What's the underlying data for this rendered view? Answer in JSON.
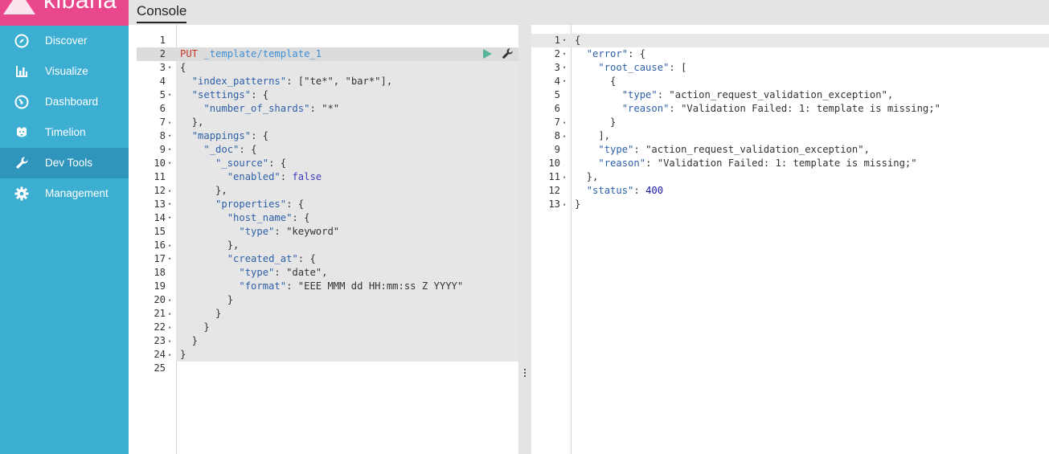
{
  "brand": {
    "name": "kibana"
  },
  "header": {
    "title": "Console"
  },
  "nav": {
    "items": [
      {
        "label": "Discover",
        "icon": "compass-icon"
      },
      {
        "label": "Visualize",
        "icon": "bar-chart-icon"
      },
      {
        "label": "Dashboard",
        "icon": "dashboard-icon"
      },
      {
        "label": "Timelion",
        "icon": "timelion-icon"
      },
      {
        "label": "Dev Tools",
        "icon": "wrench-icon",
        "active": true
      },
      {
        "label": "Management",
        "icon": "gear-icon"
      }
    ]
  },
  "request_editor": {
    "lines": [
      {
        "num": "1",
        "fold": "",
        "tokens": []
      },
      {
        "num": "2",
        "fold": "",
        "tokens": [
          {
            "t": "PUT",
            "c": "m"
          },
          {
            "t": " ",
            "c": ""
          },
          {
            "t": "_template/template_1",
            "c": "u"
          }
        ]
      },
      {
        "num": "3",
        "fold": "▾",
        "tokens": [
          {
            "t": "{",
            "c": "s"
          }
        ]
      },
      {
        "num": "4",
        "fold": "",
        "tokens": [
          {
            "t": "  ",
            "c": ""
          },
          {
            "t": "\"index_patterns\"",
            "c": "k"
          },
          {
            "t": ": [",
            "c": "s"
          },
          {
            "t": "\"te*\"",
            "c": "s"
          },
          {
            "t": ", ",
            "c": "s"
          },
          {
            "t": "\"bar*\"",
            "c": "s"
          },
          {
            "t": "],",
            "c": "s"
          }
        ]
      },
      {
        "num": "5",
        "fold": "▾",
        "tokens": [
          {
            "t": "  ",
            "c": ""
          },
          {
            "t": "\"settings\"",
            "c": "k"
          },
          {
            "t": ": {",
            "c": "s"
          }
        ]
      },
      {
        "num": "6",
        "fold": "",
        "tokens": [
          {
            "t": "    ",
            "c": ""
          },
          {
            "t": "\"number_of_shards\"",
            "c": "k"
          },
          {
            "t": ": ",
            "c": "s"
          },
          {
            "t": "\"*\"",
            "c": "s"
          }
        ]
      },
      {
        "num": "7",
        "fold": "▴",
        "tokens": [
          {
            "t": "  },",
            "c": "s"
          }
        ]
      },
      {
        "num": "8",
        "fold": "▾",
        "tokens": [
          {
            "t": "  ",
            "c": ""
          },
          {
            "t": "\"mappings\"",
            "c": "k"
          },
          {
            "t": ": {",
            "c": "s"
          }
        ]
      },
      {
        "num": "9",
        "fold": "▾",
        "tokens": [
          {
            "t": "    ",
            "c": ""
          },
          {
            "t": "\"_doc\"",
            "c": "k"
          },
          {
            "t": ": {",
            "c": "s"
          }
        ]
      },
      {
        "num": "10",
        "fold": "▾",
        "tokens": [
          {
            "t": "      ",
            "c": ""
          },
          {
            "t": "\"_source\"",
            "c": "k"
          },
          {
            "t": ": {",
            "c": "s"
          }
        ]
      },
      {
        "num": "11",
        "fold": "",
        "tokens": [
          {
            "t": "        ",
            "c": ""
          },
          {
            "t": "\"enabled\"",
            "c": "k"
          },
          {
            "t": ": ",
            "c": "s"
          },
          {
            "t": "false",
            "c": "b"
          }
        ]
      },
      {
        "num": "12",
        "fold": "▴",
        "tokens": [
          {
            "t": "      },",
            "c": "s"
          }
        ]
      },
      {
        "num": "13",
        "fold": "▾",
        "tokens": [
          {
            "t": "      ",
            "c": ""
          },
          {
            "t": "\"properties\"",
            "c": "k"
          },
          {
            "t": ": {",
            "c": "s"
          }
        ]
      },
      {
        "num": "14",
        "fold": "▾",
        "tokens": [
          {
            "t": "        ",
            "c": ""
          },
          {
            "t": "\"host_name\"",
            "c": "k"
          },
          {
            "t": ": {",
            "c": "s"
          }
        ]
      },
      {
        "num": "15",
        "fold": "",
        "tokens": [
          {
            "t": "          ",
            "c": ""
          },
          {
            "t": "\"type\"",
            "c": "k"
          },
          {
            "t": ": ",
            "c": "s"
          },
          {
            "t": "\"keyword\"",
            "c": "s"
          }
        ]
      },
      {
        "num": "16",
        "fold": "▴",
        "tokens": [
          {
            "t": "        },",
            "c": "s"
          }
        ]
      },
      {
        "num": "17",
        "fold": "▾",
        "tokens": [
          {
            "t": "        ",
            "c": ""
          },
          {
            "t": "\"created_at\"",
            "c": "k"
          },
          {
            "t": ": {",
            "c": "s"
          }
        ]
      },
      {
        "num": "18",
        "fold": "",
        "tokens": [
          {
            "t": "          ",
            "c": ""
          },
          {
            "t": "\"type\"",
            "c": "k"
          },
          {
            "t": ": ",
            "c": "s"
          },
          {
            "t": "\"date\"",
            "c": "s"
          },
          {
            "t": ",",
            "c": "s"
          }
        ]
      },
      {
        "num": "19",
        "fold": "",
        "tokens": [
          {
            "t": "          ",
            "c": ""
          },
          {
            "t": "\"format\"",
            "c": "k"
          },
          {
            "t": ": ",
            "c": "s"
          },
          {
            "t": "\"EEE MMM dd HH:mm:ss Z YYYY\"",
            "c": "s"
          }
        ]
      },
      {
        "num": "20",
        "fold": "▴",
        "tokens": [
          {
            "t": "        }",
            "c": "s"
          }
        ]
      },
      {
        "num": "21",
        "fold": "▴",
        "tokens": [
          {
            "t": "      }",
            "c": "s"
          }
        ]
      },
      {
        "num": "22",
        "fold": "▴",
        "tokens": [
          {
            "t": "    }",
            "c": "s"
          }
        ]
      },
      {
        "num": "23",
        "fold": "▴",
        "tokens": [
          {
            "t": "  }",
            "c": "s"
          }
        ]
      },
      {
        "num": "24",
        "fold": "▴",
        "tokens": [
          {
            "t": "}",
            "c": "s"
          }
        ]
      },
      {
        "num": "25",
        "fold": "",
        "tokens": []
      }
    ]
  },
  "response_editor": {
    "lines": [
      {
        "num": "1",
        "fold": "▾",
        "tokens": [
          {
            "t": "{",
            "c": "s"
          }
        ]
      },
      {
        "num": "2",
        "fold": "▾",
        "tokens": [
          {
            "t": "  ",
            "c": ""
          },
          {
            "t": "\"error\"",
            "c": "k"
          },
          {
            "t": ": {",
            "c": "s"
          }
        ]
      },
      {
        "num": "3",
        "fold": "▾",
        "tokens": [
          {
            "t": "    ",
            "c": ""
          },
          {
            "t": "\"root_cause\"",
            "c": "k"
          },
          {
            "t": ": [",
            "c": "s"
          }
        ]
      },
      {
        "num": "4",
        "fold": "▾",
        "tokens": [
          {
            "t": "      {",
            "c": "s"
          }
        ]
      },
      {
        "num": "5",
        "fold": "",
        "tokens": [
          {
            "t": "        ",
            "c": ""
          },
          {
            "t": "\"type\"",
            "c": "k"
          },
          {
            "t": ": ",
            "c": "s"
          },
          {
            "t": "\"action_request_validation_exception\"",
            "c": "s"
          },
          {
            "t": ",",
            "c": "s"
          }
        ]
      },
      {
        "num": "6",
        "fold": "",
        "tokens": [
          {
            "t": "        ",
            "c": ""
          },
          {
            "t": "\"reason\"",
            "c": "k"
          },
          {
            "t": ": ",
            "c": "s"
          },
          {
            "t": "\"Validation Failed: 1: template is missing;\"",
            "c": "s"
          }
        ]
      },
      {
        "num": "7",
        "fold": "▴",
        "tokens": [
          {
            "t": "      }",
            "c": "s"
          }
        ]
      },
      {
        "num": "8",
        "fold": "▴",
        "tokens": [
          {
            "t": "    ],",
            "c": "s"
          }
        ]
      },
      {
        "num": "9",
        "fold": "",
        "tokens": [
          {
            "t": "    ",
            "c": ""
          },
          {
            "t": "\"type\"",
            "c": "k"
          },
          {
            "t": ": ",
            "c": "s"
          },
          {
            "t": "\"action_request_validation_exception\"",
            "c": "s"
          },
          {
            "t": ",",
            "c": "s"
          }
        ]
      },
      {
        "num": "10",
        "fold": "",
        "tokens": [
          {
            "t": "    ",
            "c": ""
          },
          {
            "t": "\"reason\"",
            "c": "k"
          },
          {
            "t": ": ",
            "c": "s"
          },
          {
            "t": "\"Validation Failed: 1: template is missing;\"",
            "c": "s"
          }
        ]
      },
      {
        "num": "11",
        "fold": "▴",
        "tokens": [
          {
            "t": "  },",
            "c": "s"
          }
        ]
      },
      {
        "num": "12",
        "fold": "",
        "tokens": [
          {
            "t": "  ",
            "c": ""
          },
          {
            "t": "\"status\"",
            "c": "k"
          },
          {
            "t": ": ",
            "c": "s"
          },
          {
            "t": "400",
            "c": "n"
          }
        ]
      },
      {
        "num": "13",
        "fold": "▴",
        "tokens": [
          {
            "t": "}",
            "c": "s"
          }
        ]
      }
    ]
  },
  "actions": {
    "run_icon": "play-icon",
    "settings_icon": "wrench-icon"
  },
  "colors": {
    "sidebar": "#3caed2",
    "sidebar_active": "#2f95bc",
    "brand": "#e8478b",
    "run": "#54b399"
  }
}
